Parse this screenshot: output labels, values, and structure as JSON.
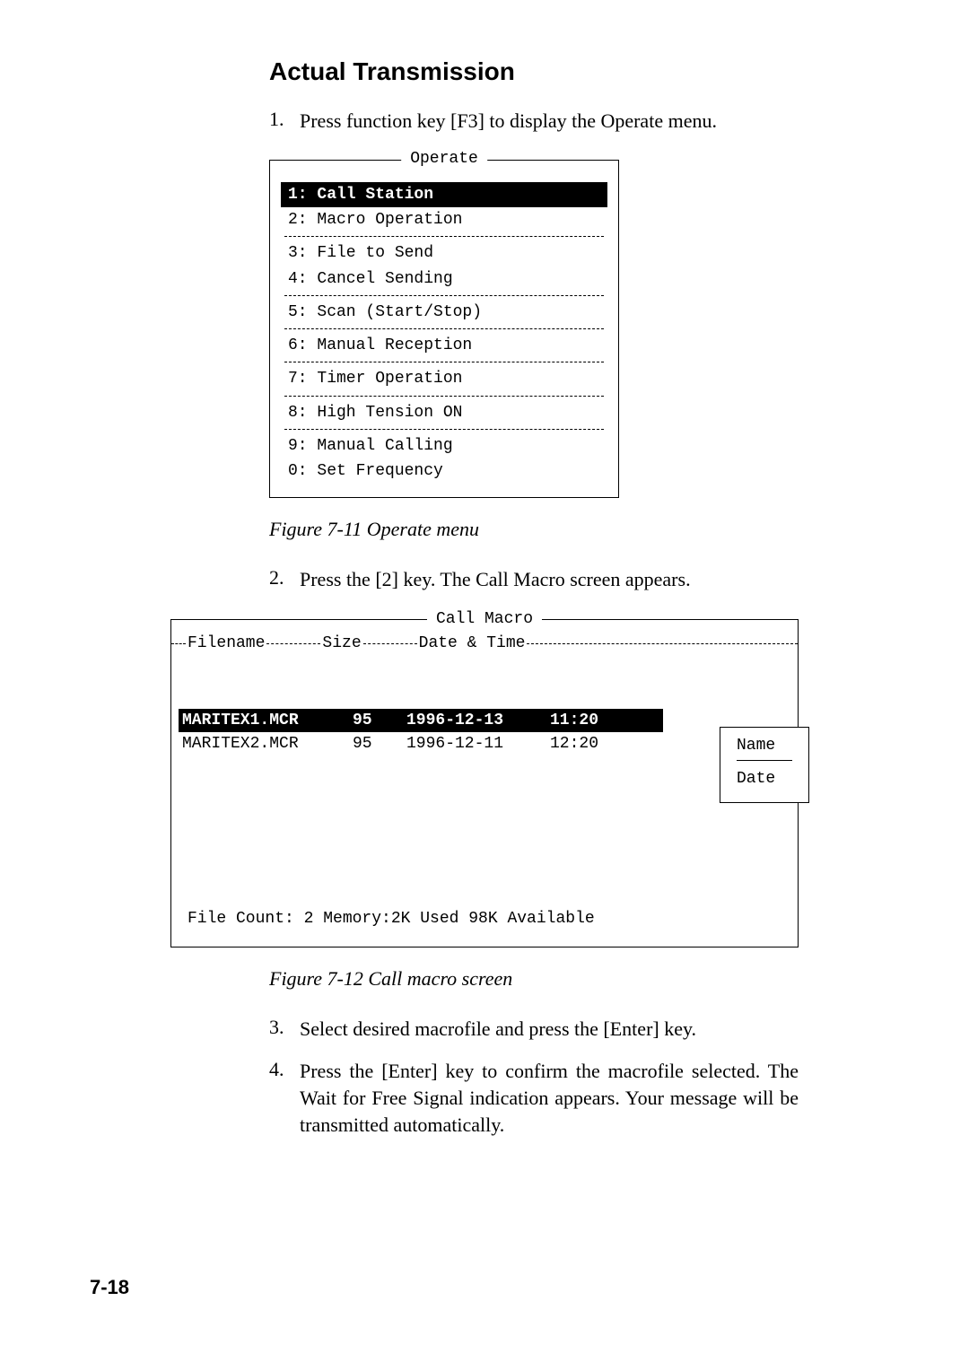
{
  "heading": "Actual Transmission",
  "steps": {
    "s1_num": "1.",
    "s1_txt": "Press function key [F3] to display the Operate menu.",
    "s2_num": "2.",
    "s2_txt": "Press the [2] key. The Call Macro screen appears.",
    "s3_num": "3.",
    "s3_txt": "Select desired macrofile and press the [Enter] key.",
    "s4_num": "4.",
    "s4_txt": "Press the [Enter] key to confirm the macrofile selected. The Wait for Free Signal indication appears. Your message will be transmitted automatically."
  },
  "operate": {
    "legend": "Operate",
    "items": {
      "i1": "1: Call Station",
      "i2": "2: Macro Operation",
      "i3": "3: File to Send",
      "i4": "4: Cancel Sending",
      "i5": "5: Scan (Start/Stop)",
      "i6": "6: Manual Reception",
      "i7": "7: Timer Operation",
      "i8": "8: High Tension ON",
      "i9": "9: Manual Calling",
      "i0": "0: Set Frequency"
    },
    "caption": "Figure 7-11 Operate menu"
  },
  "callmacro": {
    "legend": "Call Macro",
    "cols": {
      "c1": "Filename",
      "c2": "Size",
      "c3": "Date & Time"
    },
    "rows": [
      {
        "name": "MARITEX1.MCR",
        "size": "95",
        "date": "1996-12-13",
        "time": "11:20"
      },
      {
        "name": "MARITEX2.MCR",
        "size": "95",
        "date": "1996-12-11",
        "time": "12:20"
      }
    ],
    "status": "File Count: 2    Memory:2K Used    98K Available",
    "sidebox": {
      "name": "Name",
      "date": "Date"
    },
    "caption": "Figure 7-12 Call macro screen"
  },
  "page_number": "7-18"
}
